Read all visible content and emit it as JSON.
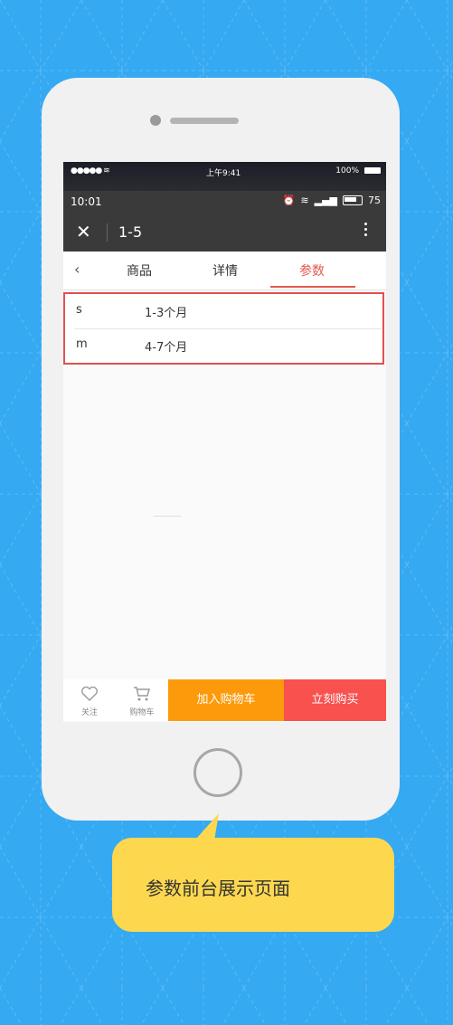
{
  "ios_status": {
    "carrier": "●●●●● ≋",
    "clock": "上午9:41",
    "battery": "100%"
  },
  "android_status": {
    "time": "10:01",
    "battery_level": "75"
  },
  "app_bar": {
    "title": "1-5"
  },
  "tabs": [
    {
      "label": "商品",
      "active": false
    },
    {
      "label": "详情",
      "active": false
    },
    {
      "label": "参数",
      "active": true
    }
  ],
  "params": [
    {
      "key": "s",
      "value": "1-3个月"
    },
    {
      "key": "m",
      "value": "4-7个月"
    }
  ],
  "bottom_bar": {
    "follow_label": "关注",
    "cart_label": "购物车",
    "add_to_cart": "加入购物车",
    "buy_now": "立刻购买"
  },
  "caption": "参数前台展示页面",
  "colors": {
    "background": "#35a9f2",
    "accent_red": "#e35a4e",
    "orange_button": "#fd9a0b",
    "red_button": "#f8514e",
    "bubble": "#fdd84f"
  }
}
